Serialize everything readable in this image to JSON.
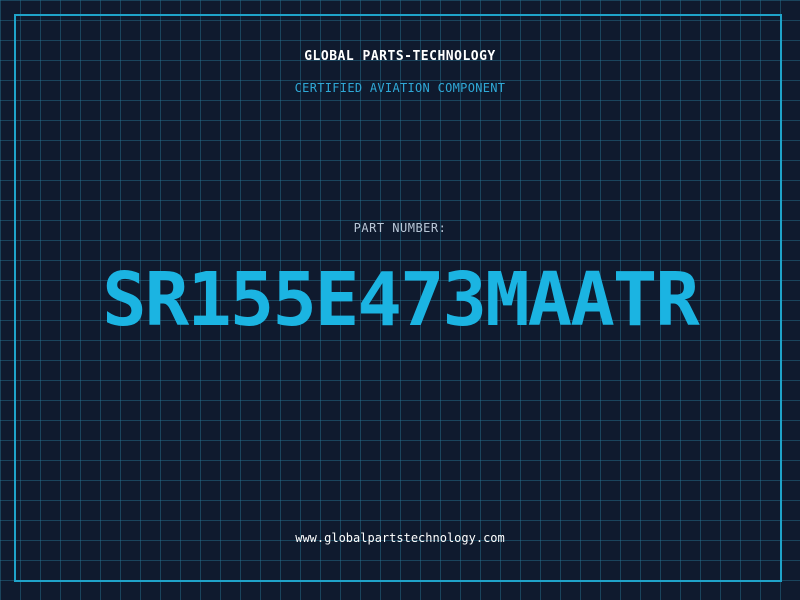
{
  "header": {
    "company": "GLOBAL PARTS-TECHNOLOGY",
    "subtitle": "CERTIFIED AVIATION COMPONENT"
  },
  "part": {
    "label": "PART NUMBER:",
    "number": "SR155E473MAATR"
  },
  "footer": {
    "website": "www.globalpartstechnology.com"
  },
  "colors": {
    "background": "#0f1a2e",
    "grid": "#287896",
    "frame": "#1fa3c9",
    "accent": "#1bb4e2",
    "subtitle": "#2fa8d6"
  }
}
